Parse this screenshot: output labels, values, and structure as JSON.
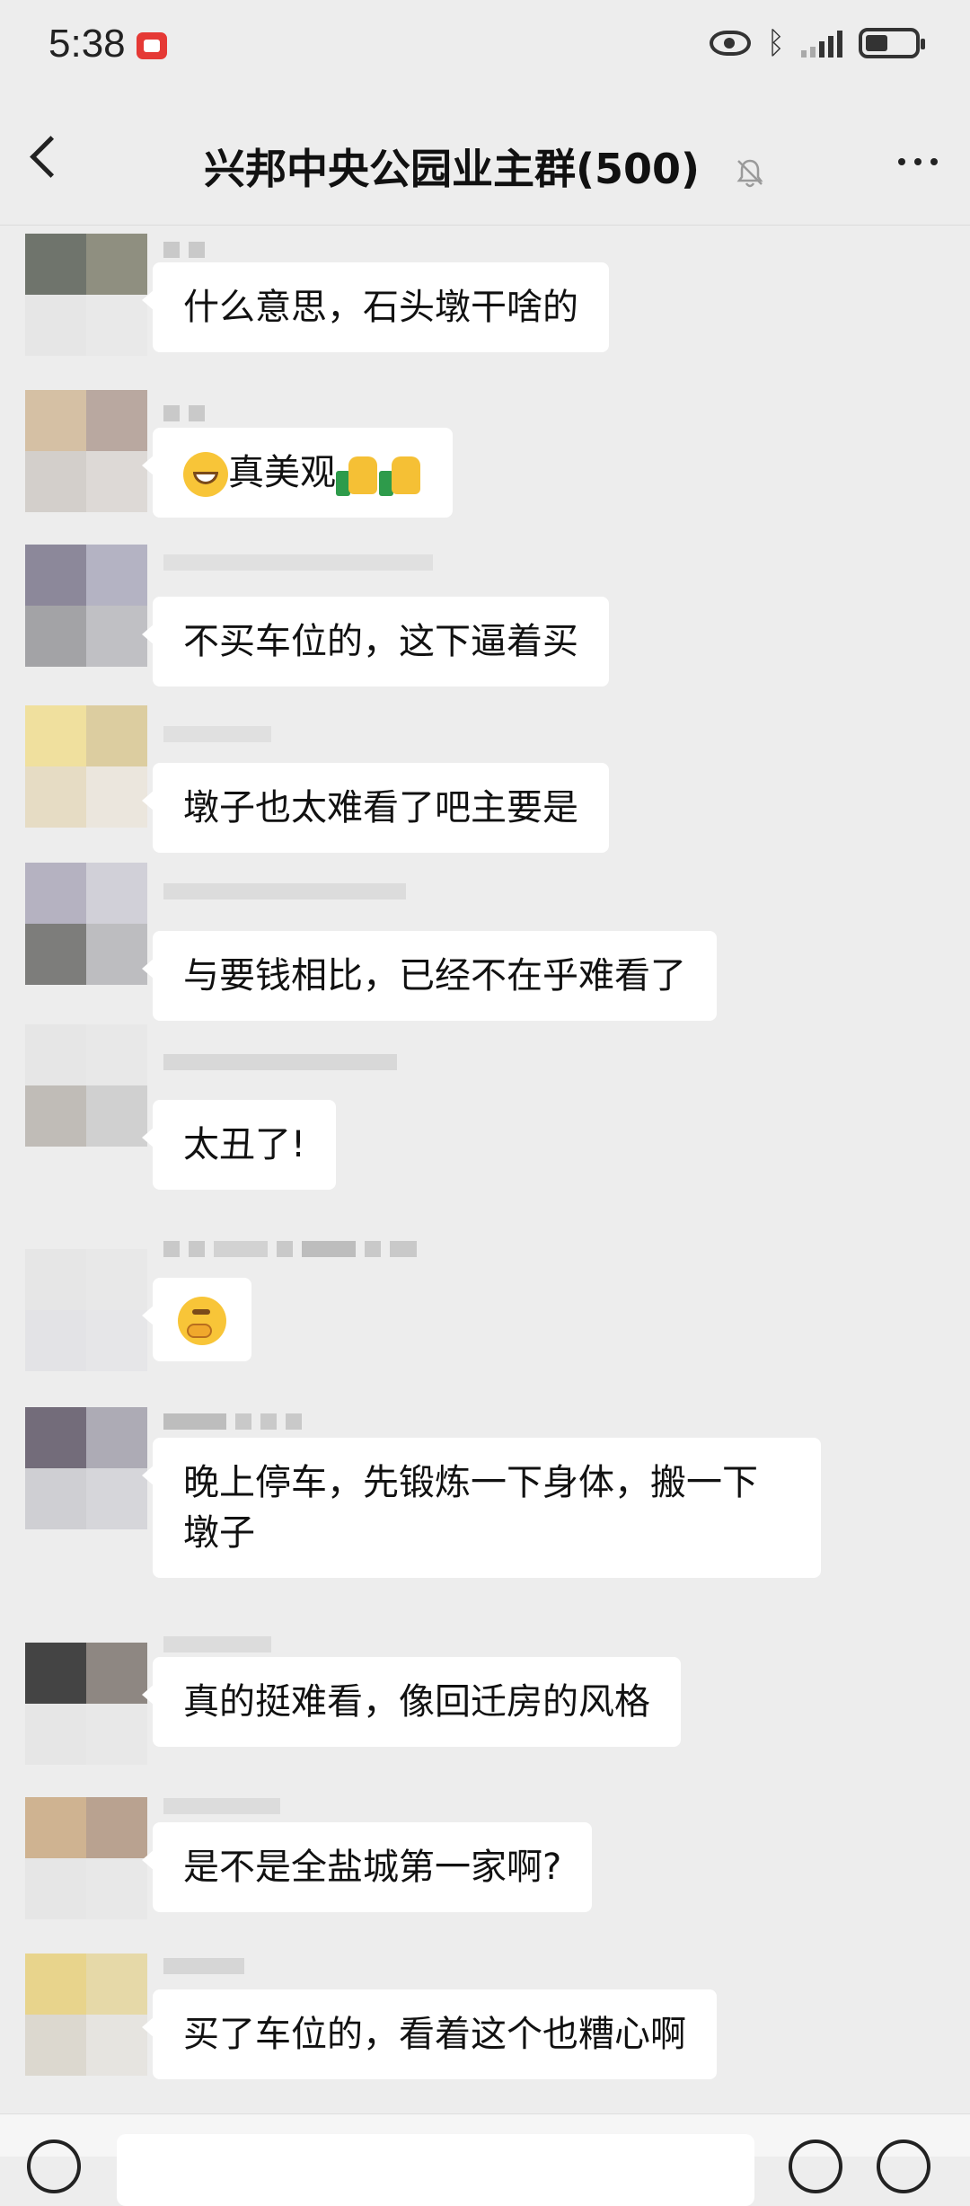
{
  "status_bar": {
    "time": "5:38",
    "icons": [
      "recording-icon",
      "eye-icon",
      "bluetooth-icon",
      "signal-icon",
      "battery-icon"
    ]
  },
  "header": {
    "title": "兴邦中央公园业主群(500)",
    "icons": [
      "back-arrow-icon",
      "mute-bell-icon",
      "more-icon"
    ]
  },
  "messages": [
    {
      "text": "什么意思，石头墩干啥的",
      "avatar_colors": [
        "#6f746c",
        "#8f8f80",
        "#e6e6e6",
        "#e9e9e9"
      ]
    },
    {
      "text": "真美观",
      "emoji_before": "grinning-face-icon",
      "emoji_after": [
        "thumbs-up-icon",
        "thumbs-up-icon"
      ],
      "avatar_colors": [
        "#d5c0a4",
        "#b9a8a0",
        "#d3cfcb",
        "#ddd9d6"
      ]
    },
    {
      "text": "不买车位的，这下逼着买",
      "avatar_colors": [
        "#8c889a",
        "#b4b3c3",
        "#a3a3a6",
        "#c0c0c4"
      ]
    },
    {
      "text": "墩子也太难看了吧主要是",
      "avatar_colors": [
        "#f0e09e",
        "#dccda0",
        "#e6dcc4",
        "#ebe6dd"
      ]
    },
    {
      "text": "与要钱相比，已经不在乎难看了",
      "avatar_colors": [
        "#b5b2c1",
        "#d1d0d8",
        "#7d7d7b",
        "#bdbdc0"
      ]
    },
    {
      "text": "太丑了!",
      "avatar_colors": [
        "#e6e6e6",
        "#e8e8e8",
        "#c0bcb7",
        "#d0d0d0"
      ]
    },
    {
      "text": "",
      "emoji_before": "thinking-face-icon",
      "avatar_colors": [
        "#e6e6e6",
        "#e8e8e8",
        "#e3e3e6",
        "#e6e6e8"
      ]
    },
    {
      "text": "晚上停车，先锻炼一下身体，搬一下墩子",
      "avatar_colors": [
        "#736c7a",
        "#adabb5",
        "#cfcfd3",
        "#d6d6da"
      ]
    },
    {
      "text": "真的挺难看，像回迁房的风格",
      "avatar_colors": [
        "#444444",
        "#8e8782",
        "#e6e6e6",
        "#e8e8e8"
      ]
    },
    {
      "text": "是不是全盐城第一家啊?",
      "avatar_colors": [
        "#cfb391",
        "#b9a290",
        "#e6e6e6",
        "#e8e8e8"
      ]
    },
    {
      "text": "买了车位的，看着这个也糟心啊",
      "avatar_colors": [
        "#e8d48c",
        "#e6d9a8",
        "#dcd8cf",
        "#e6e4e0"
      ]
    }
  ],
  "input_bar": {
    "icons": [
      "voice-icon",
      "emoji-icon",
      "plus-icon"
    ]
  }
}
